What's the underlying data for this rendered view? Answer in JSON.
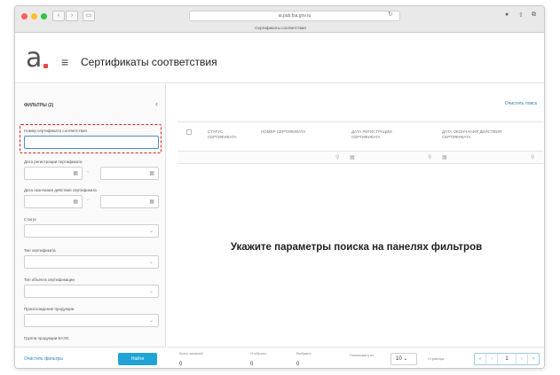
{
  "browser": {
    "url": "ai.pub.fsa.gov.ru",
    "tab_title": "Сертификаты соответствия",
    "colors": {
      "close": "#ff5f57",
      "minimize": "#febc2e",
      "zoom": "#28c840"
    }
  },
  "header": {
    "logo": "а",
    "title": "Сертификаты соответствия"
  },
  "sidebar": {
    "filters_title": "ФИЛЬТРЫ (2)",
    "filters": [
      {
        "label": "Номер сертификата соответствия",
        "type": "text",
        "value": ""
      },
      {
        "label": "Дата регистрации сертификата",
        "type": "daterange"
      },
      {
        "label": "Дата окончания действия сертификата",
        "type": "daterange"
      },
      {
        "label": "Статус",
        "type": "select"
      },
      {
        "label": "Тип сертификата",
        "type": "select"
      },
      {
        "label": "Тип объекта сертификации",
        "type": "select"
      },
      {
        "label": "Происхождение продукции",
        "type": "select"
      },
      {
        "label": "Группа продукции ЕАЭС",
        "type": "select"
      }
    ],
    "clear_label": "Очистить фильтры",
    "find_label": "Найти"
  },
  "main": {
    "clear_search": "Очистить поиск",
    "columns": [
      "Статус сертификата",
      "Номер сертификата",
      "Дата регистрации сертификата",
      "Дата окончания действия сертификата"
    ],
    "empty_message": "Укажите параметры поиска на панелях фильтров",
    "footer": {
      "stats": [
        {
          "label": "Всего записей",
          "value": "0"
        },
        {
          "label": "Отобрано",
          "value": "0"
        },
        {
          "label": "Выбрано",
          "value": "0"
        }
      ],
      "page_size_label": "Показывать по",
      "page_size": "10",
      "pages_label": "Страница",
      "current_page": "1"
    }
  }
}
